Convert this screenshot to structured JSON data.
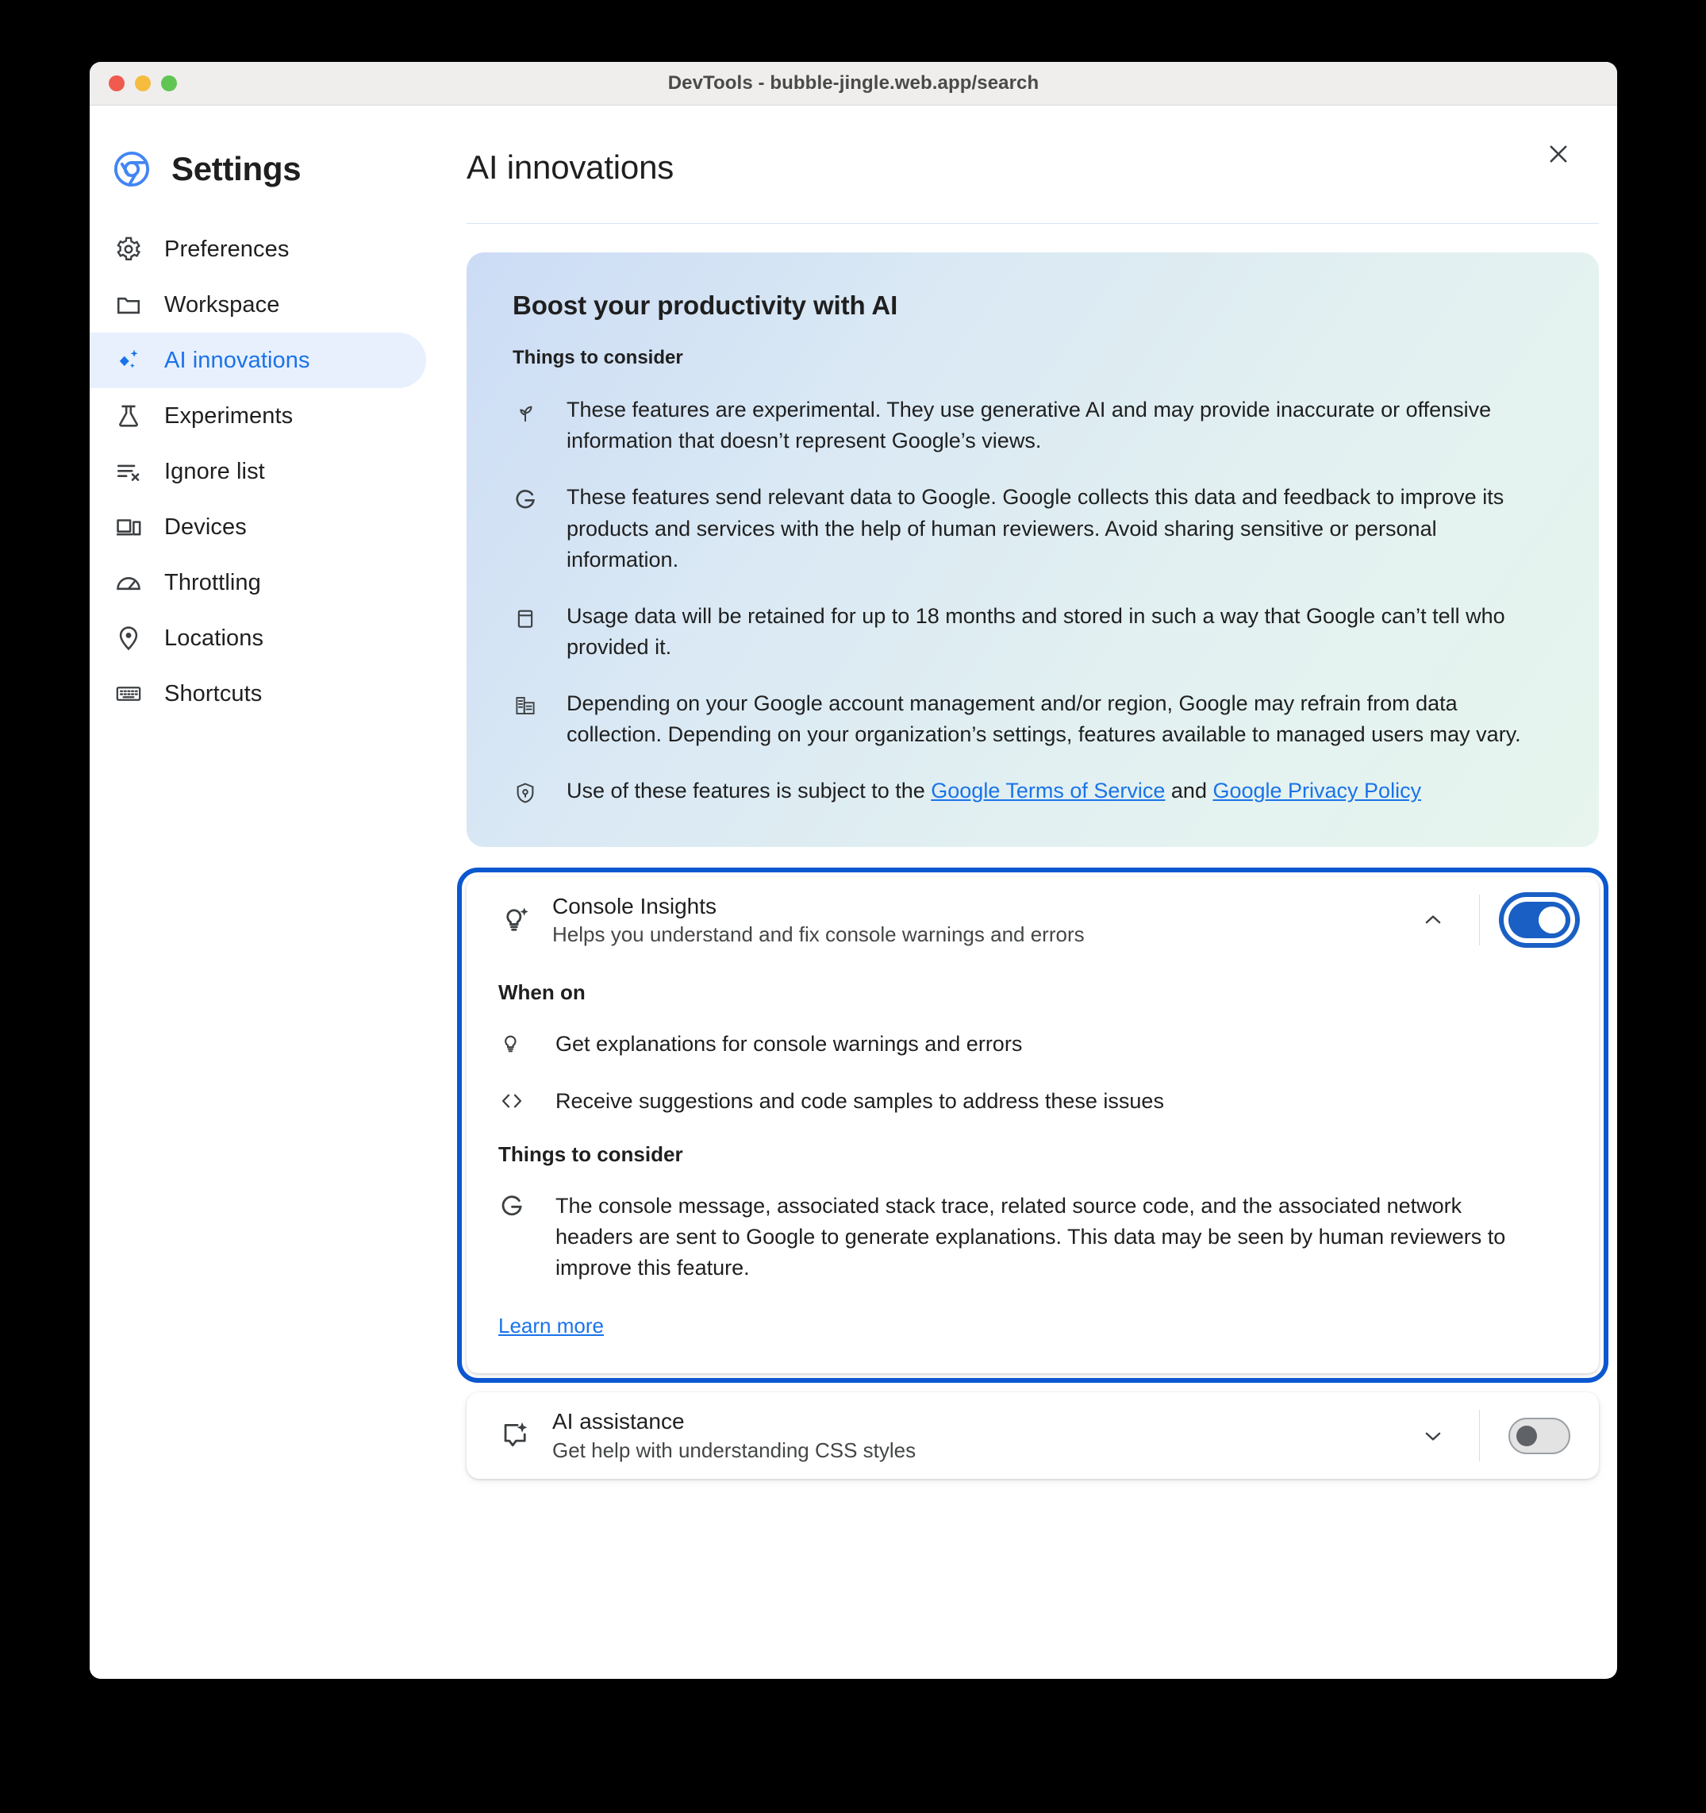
{
  "window": {
    "title": "DevTools - bubble-jingle.web.app/search"
  },
  "sidebar": {
    "brand": "Settings",
    "items": [
      {
        "label": "Preferences",
        "icon": "gear-icon"
      },
      {
        "label": "Workspace",
        "icon": "folder-icon"
      },
      {
        "label": "AI innovations",
        "icon": "sparkle-diamond-icon"
      },
      {
        "label": "Experiments",
        "icon": "flask-icon"
      },
      {
        "label": "Ignore list",
        "icon": "list-x-icon"
      },
      {
        "label": "Devices",
        "icon": "devices-icon"
      },
      {
        "label": "Throttling",
        "icon": "gauge-icon"
      },
      {
        "label": "Locations",
        "icon": "location-pin-icon"
      },
      {
        "label": "Shortcuts",
        "icon": "keyboard-icon"
      }
    ]
  },
  "main": {
    "page_title": "AI innovations",
    "close_icon": "close-icon"
  },
  "info_panel": {
    "title": "Boost your productivity with AI",
    "subtitle": "Things to consider",
    "bullets": [
      {
        "icon": "sprout-icon",
        "text": "These features are experimental. They use generative AI and may provide inaccurate or offensive information that doesn’t represent Google’s views."
      },
      {
        "icon": "google-g-icon",
        "text": "These features send relevant data to Google. Google collects this data and feedback to improve its products and services with the help of human reviewers. Avoid sharing sensitive or personal information."
      },
      {
        "icon": "calendar-icon",
        "text": "Usage data will be retained for up to 18 months and stored in such a way that Google can’t tell who provided it."
      },
      {
        "icon": "corporate-icon",
        "text": "Depending on your Google account management and/or region, Google may refrain from data collection. Depending on your organization’s settings, features available to managed users may vary."
      }
    ],
    "legal": {
      "prefix": "Use of these features is subject to the ",
      "link1": "Google Terms of Service",
      "middle": " and ",
      "link2": "Google Privacy Policy",
      "icon": "policy-shield-icon"
    }
  },
  "console_insights": {
    "icon": "lightbulb-sparkle-icon",
    "title": "Console Insights",
    "description": "Helps you understand and fix console warnings and errors",
    "chevron": "chevron-up-icon",
    "toggle_state": "on",
    "when_on_heading": "When on",
    "when_on": [
      {
        "icon": "lightbulb-icon",
        "text": "Get explanations for console warnings and errors"
      },
      {
        "icon": "code-brackets-icon",
        "text": "Receive suggestions and code samples to address these issues"
      }
    ],
    "consider_heading": "Things to consider",
    "consider": [
      {
        "icon": "google-g-icon",
        "text": "The console message, associated stack trace, related source code, and the associated network headers are sent to Google to generate explanations. This data may be seen by human reviewers to improve this feature."
      }
    ],
    "learn_more": "Learn more"
  },
  "ai_assistance": {
    "icon": "chat-sparkle-icon",
    "title": "AI assistance",
    "description": "Get help with understanding CSS styles",
    "chevron": "chevron-down-icon",
    "toggle_state": "off"
  },
  "colors": {
    "accent": "#1a73e8",
    "focus_ring": "#0b57d0",
    "toggle_on": "#1a5fc4",
    "sidebar_active_bg": "#e8f0fe",
    "panel_gradient_start": "#ccdcf5",
    "panel_gradient_end": "#e7f5ee"
  }
}
